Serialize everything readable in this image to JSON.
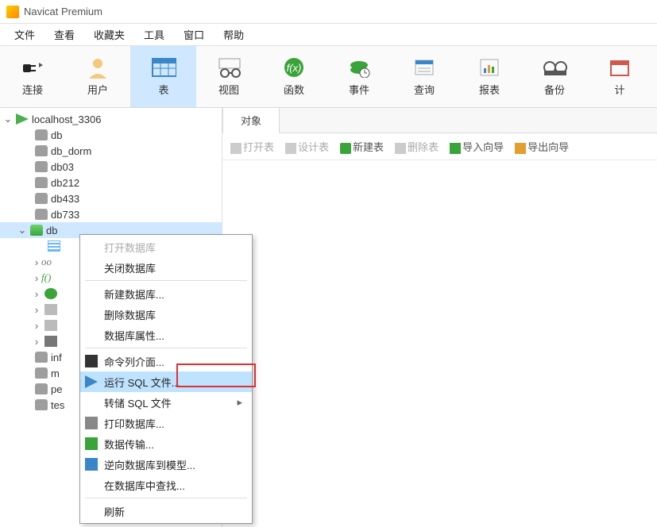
{
  "app": {
    "title": "Navicat Premium"
  },
  "menubar": [
    "文件",
    "查看",
    "收藏夹",
    "工具",
    "窗口",
    "帮助"
  ],
  "toolbar": [
    {
      "id": "connect",
      "label": "连接"
    },
    {
      "id": "user",
      "label": "用户"
    },
    {
      "id": "table",
      "label": "表",
      "selected": true
    },
    {
      "id": "view",
      "label": "视图"
    },
    {
      "id": "func",
      "label": "函数"
    },
    {
      "id": "event",
      "label": "事件"
    },
    {
      "id": "query",
      "label": "查询"
    },
    {
      "id": "report",
      "label": "报表"
    },
    {
      "id": "backup",
      "label": "备份"
    },
    {
      "id": "schedule",
      "label": "计"
    }
  ],
  "tree": {
    "connection": "localhost_3306",
    "dbs": [
      "db",
      "db_dorm",
      "db03",
      "db212",
      "db433",
      "db733"
    ],
    "selected_db": "db",
    "child_labels": [
      "inf",
      "m",
      "pe",
      "tes"
    ]
  },
  "tab": {
    "label": "对象"
  },
  "subbar": {
    "open_table": "打开表",
    "design_table": "设计表",
    "new_table": "新建表",
    "delete_table": "删除表",
    "import_wizard": "导入向导",
    "export_wizard": "导出向导"
  },
  "context_menu": {
    "open_db": "打开数据库",
    "close_db": "关闭数据库",
    "new_db": "新建数据库...",
    "delete_db": "删除数据库",
    "db_props": "数据库属性...",
    "cli": "命令列介面...",
    "run_sql": "运行 SQL 文件...",
    "dump_sql": "转储 SQL 文件",
    "print_db": "打印数据库...",
    "data_transfer": "数据传输...",
    "reverse_model": "逆向数据库到模型...",
    "find_in_db": "在数据库中查找...",
    "refresh": "刷新"
  }
}
